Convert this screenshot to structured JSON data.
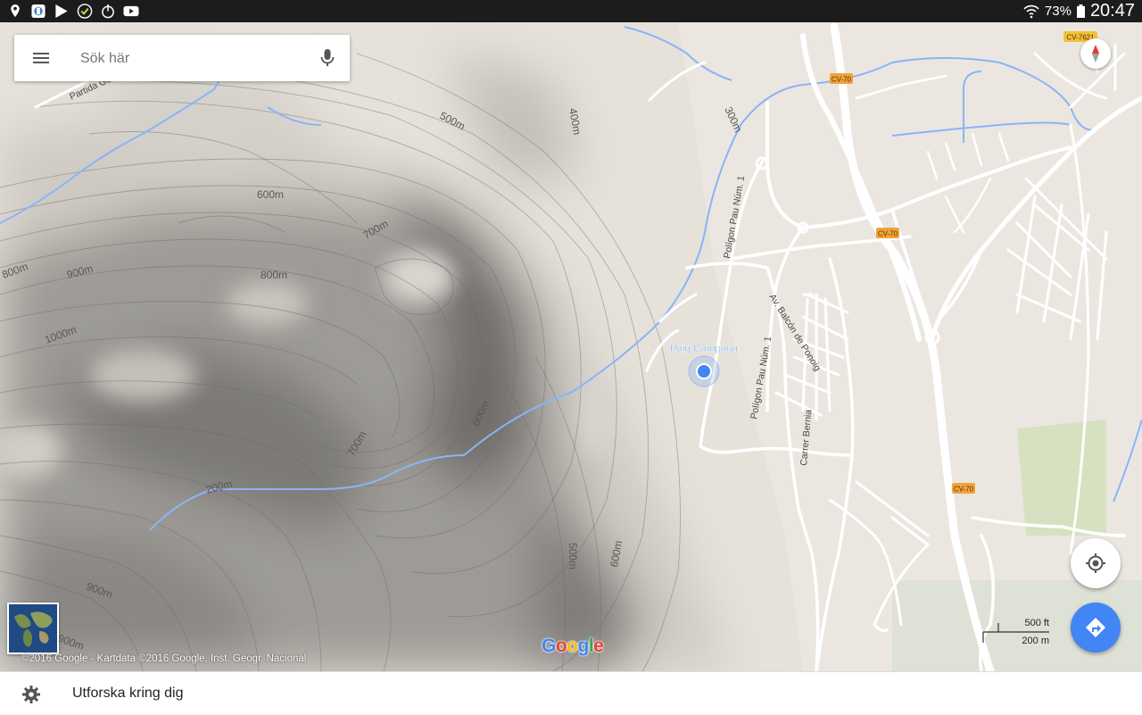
{
  "status_bar": {
    "battery": "73%",
    "time": "20:47",
    "icons": [
      "location-pin-icon",
      "app-icon",
      "play-movies-icon",
      "check-circle-icon",
      "power-icon",
      "youtube-icon",
      "wifi-icon",
      "battery-icon"
    ]
  },
  "search": {
    "placeholder": "Sök här"
  },
  "map": {
    "place_label": "Puig Campana",
    "streets": [
      "Polígon Pau Núm. 1",
      "Av. Balcón de Ponoig",
      "Polígon Pau Núm. 1",
      "Carrer Bernia",
      "Partida Ge"
    ],
    "road_shields": [
      "CV-70",
      "CV-70",
      "CV-70",
      "CV-7621"
    ],
    "contour_labels": [
      "500m",
      "400m",
      "300m",
      "600m",
      "700m",
      "800m",
      "900m",
      "800m",
      "1000m",
      "600m",
      "700m",
      "200m",
      "500m",
      "600m",
      "900m",
      "900m"
    ],
    "copyright": "©2016 Google - Kartdata ©2016 Google, Inst. Geogr. Nacional",
    "logo": "Google",
    "scale": {
      "imperial": "500 ft",
      "metric": "200 m"
    },
    "colors": {
      "water": "#8ab4f8",
      "road": "#ffffff",
      "shield": "#f2a33a",
      "location": "#4285f4"
    }
  },
  "bottom_bar": {
    "explore_label": "Utforska kring dig"
  }
}
